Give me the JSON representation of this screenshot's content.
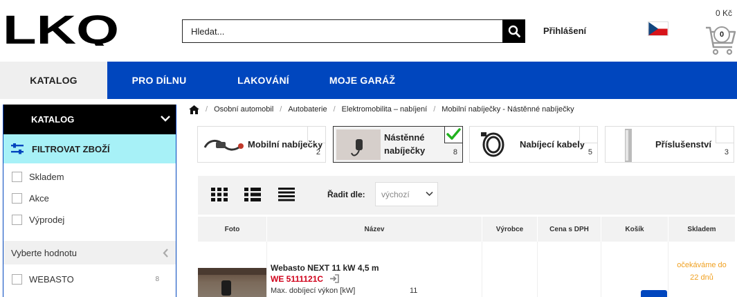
{
  "header": {
    "logo_text": "LKQ",
    "search": {
      "placeholder": "Hledat..."
    },
    "login_label": "Přihlášení",
    "cart_price": "0 Kč",
    "cart_count": "0"
  },
  "nav": {
    "items": [
      {
        "label": "KATALOG",
        "active": true
      },
      {
        "label": "PRO DÍLNU",
        "active": false
      },
      {
        "label": "LAKOVÁNÍ",
        "active": false
      },
      {
        "label": "MOJE GARÁŽ",
        "active": false
      }
    ]
  },
  "sidebar": {
    "title": "KATALOG",
    "filter_label": "FILTROVAT ZBOŽÍ",
    "checkboxes": [
      "Skladem",
      "Akce",
      "Výprodej"
    ],
    "select_value_label": "Vyberte hodnotu",
    "brands": [
      {
        "name": "WEBASTO",
        "count": "8"
      }
    ]
  },
  "breadcrumb": [
    "Osobní automobil",
    "Autobaterie",
    "Elektromobilita – nabíjení",
    "Mobilní nabíječky - Nástěnné nabíječky"
  ],
  "categories": [
    {
      "label": "Mobilní nabíječky",
      "count": "2"
    },
    {
      "label_line1": "Nástěnné",
      "label_line2": "nabíječky",
      "count": "8",
      "selected": true
    },
    {
      "label": "Nabíjecí kabely",
      "count": "5"
    },
    {
      "label": "Příslušenství",
      "count": "3"
    }
  ],
  "toolbar": {
    "sort_label": "Řadit dle:",
    "sort_value": "výchozí"
  },
  "table": {
    "headers": [
      "Foto",
      "Název",
      "Výrobce",
      "Cena s DPH",
      "Košík",
      "Skladem"
    ],
    "rows": [
      {
        "name": "Webasto NEXT 11 kW 4,5 m",
        "code": "WE 5111121C",
        "spec_label": "Max. dobíjecí výkon [kW]",
        "spec_value": "11",
        "stock_line1": "očekáváme do",
        "stock_line2": "22 dnů"
      }
    ]
  },
  "colors": {
    "brand_blue": "#0046be",
    "filter_cyan": "#a7f1f7",
    "code_red": "#d0021b",
    "stock_orange": "#f0a020",
    "check_green": "#21b21e"
  }
}
